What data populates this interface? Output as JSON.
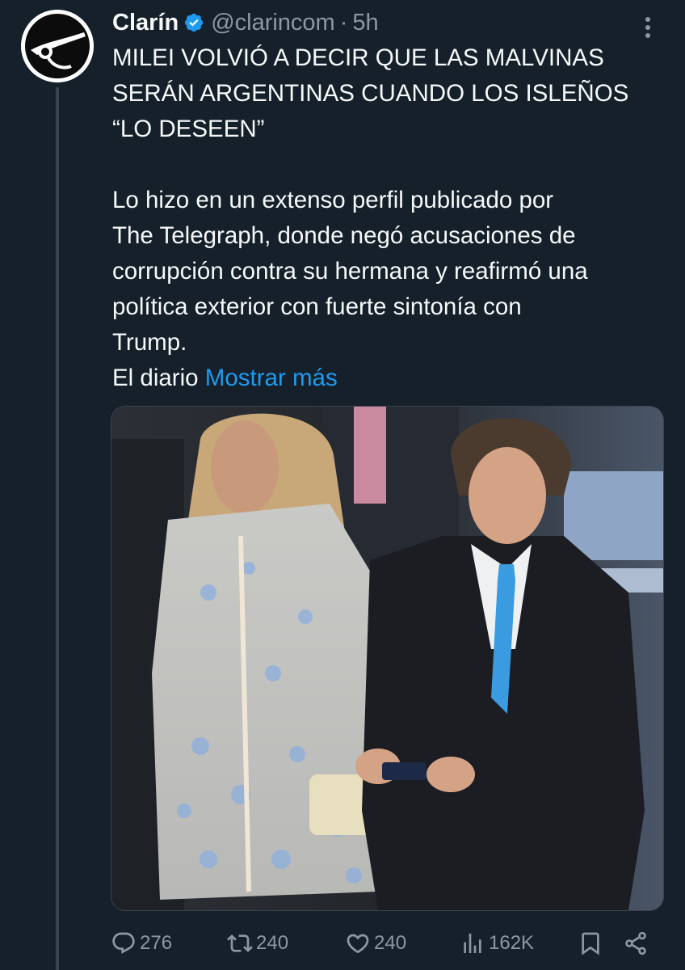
{
  "author": {
    "name": "Clarín",
    "handle": "@clarincom",
    "separator": "·",
    "time": "5h",
    "verified_color": "#1d9bf0"
  },
  "tweet": {
    "headline_lines": [
      "MILEI VOLVIÓ A DECIR QUE LAS MALVINAS",
      "SERÁN ARGENTINAS CUANDO LOS ISLEÑOS",
      "“LO DESEEN”"
    ],
    "body_lines": [
      "Lo hizo en un extenso perfil publicado por",
      "The Telegraph, donde negó acusaciones de",
      "corrupción contra su hermana y reafirmó una",
      "política exterior con fuerte sintonía con",
      "Trump."
    ],
    "last_line_prefix": "El diario",
    "show_more": "Mostrar más"
  },
  "actions": {
    "replies": "276",
    "retweets": "240",
    "likes": "240",
    "views": "162K"
  },
  "icons": {
    "avatar": "clarin-logo",
    "verified": "verified-badge-icon",
    "more": "more-vertical-icon",
    "reply": "reply-icon",
    "retweet": "retweet-icon",
    "like": "heart-icon",
    "views": "views-chart-icon",
    "bookmark": "bookmark-icon",
    "share": "share-icon"
  },
  "colors": {
    "background": "#15202b",
    "text": "#f7f9f9",
    "muted": "#8b98a5",
    "link": "#1d9bf0"
  }
}
